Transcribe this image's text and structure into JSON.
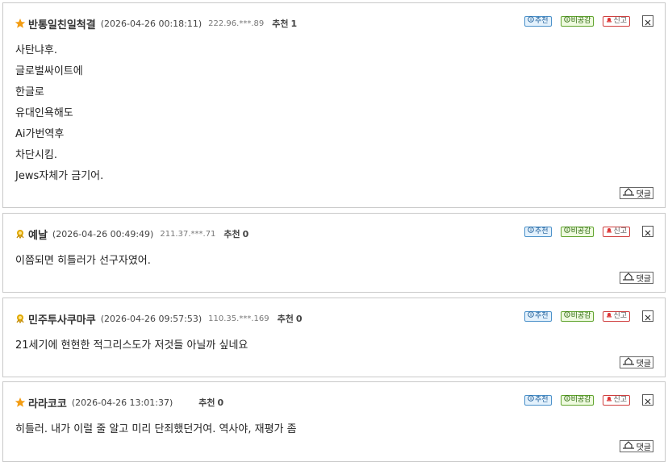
{
  "labels": {
    "recommend_word": "추천",
    "recommend_btn": "추천",
    "oppose_btn": "비공감",
    "report_btn": "신고",
    "reply_btn": "댓글"
  },
  "icons": {
    "star": "star-icon",
    "rank": "rank-badge-icon",
    "recommend": "info-circle-icon",
    "oppose": "info-circle-icon",
    "report": "siren-icon",
    "close": "close-icon",
    "reply": "reply-icon"
  },
  "colors": {
    "star": "#f39c12",
    "rank_badge": "#e0a800",
    "recommend_border": "#4a90c9",
    "oppose_border": "#5fa32c",
    "report_border": "#cf3e3e"
  },
  "comments": [
    {
      "icon": "star",
      "nickname": "반통일친일척결",
      "datetime": "(2026-04-26 00:18:11)",
      "ip": "222.96.***.89",
      "recommend_count": "1",
      "lines": [
        "사탄냐후.",
        "글로벌싸이트에",
        "한글로",
        "유대인욕해도",
        "Ai가번역후",
        "차단시킴.",
        "Jews자체가 금기어."
      ]
    },
    {
      "icon": "rank",
      "nickname": "예날",
      "datetime": "(2026-04-26 00:49:49)",
      "ip": "211.37.***.71",
      "recommend_count": "0",
      "lines": [
        "이쯤되면 히틀러가 선구자였어."
      ]
    },
    {
      "icon": "rank",
      "nickname": "민주투사쿠마쿠",
      "datetime": "(2026-04-26 09:57:53)",
      "ip": "110.35.***.169",
      "recommend_count": "0",
      "lines": [
        "21세기에 현현한 적그리스도가 저것들 아닐까 싶네요"
      ]
    },
    {
      "icon": "star",
      "nickname": "라라코코",
      "datetime": "(2026-04-26 13:01:37)",
      "ip": "",
      "recommend_count": "0",
      "lines": [
        "히틀러. 내가 이럴 줄 알고 미리 단죄했던거여. 역사야, 재평가 좀"
      ]
    }
  ]
}
